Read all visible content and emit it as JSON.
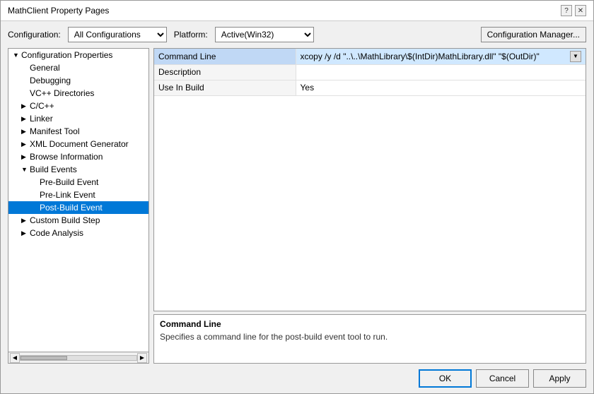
{
  "dialog": {
    "title": "MathClient Property Pages",
    "help_btn": "?",
    "close_btn": "✕"
  },
  "config_bar": {
    "config_label": "Configuration:",
    "config_value": "All Configurations",
    "platform_label": "Platform:",
    "platform_value": "Active(Win32)",
    "manager_btn": "Configuration Manager..."
  },
  "tree": {
    "items": [
      {
        "id": "config-props",
        "label": "Configuration Properties",
        "level": 0,
        "expanded": true,
        "has_children": true
      },
      {
        "id": "general",
        "label": "General",
        "level": 1,
        "expanded": false,
        "has_children": false
      },
      {
        "id": "debugging",
        "label": "Debugging",
        "level": 1,
        "expanded": false,
        "has_children": false
      },
      {
        "id": "vc-dirs",
        "label": "VC++ Directories",
        "level": 1,
        "expanded": false,
        "has_children": false
      },
      {
        "id": "cpp",
        "label": "C/C++",
        "level": 1,
        "expanded": false,
        "has_children": true,
        "collapsed": true
      },
      {
        "id": "linker",
        "label": "Linker",
        "level": 1,
        "expanded": false,
        "has_children": true,
        "collapsed": true
      },
      {
        "id": "manifest",
        "label": "Manifest Tool",
        "level": 1,
        "expanded": false,
        "has_children": true,
        "collapsed": true
      },
      {
        "id": "xml-doc",
        "label": "XML Document Generator",
        "level": 1,
        "expanded": false,
        "has_children": true,
        "collapsed": true
      },
      {
        "id": "browse",
        "label": "Browse Information",
        "level": 1,
        "expanded": false,
        "has_children": true,
        "collapsed": true
      },
      {
        "id": "build-events",
        "label": "Build Events",
        "level": 1,
        "expanded": true,
        "has_children": true
      },
      {
        "id": "pre-build",
        "label": "Pre-Build Event",
        "level": 2,
        "expanded": false,
        "has_children": false
      },
      {
        "id": "pre-link",
        "label": "Pre-Link Event",
        "level": 2,
        "expanded": false,
        "has_children": false
      },
      {
        "id": "post-build",
        "label": "Post-Build Event",
        "level": 2,
        "expanded": false,
        "has_children": false,
        "selected": true
      },
      {
        "id": "custom-build",
        "label": "Custom Build Step",
        "level": 1,
        "expanded": false,
        "has_children": true,
        "collapsed": true
      },
      {
        "id": "code-analysis",
        "label": "Code Analysis",
        "level": 1,
        "expanded": false,
        "has_children": true,
        "collapsed": true
      }
    ]
  },
  "grid": {
    "rows": [
      {
        "name": "Command Line",
        "value": "xcopy /y /d \"..\\..\\MathLibrary\\$(IntDir)MathLibrary.dll\" \"$(OutDir)\"",
        "selected": true,
        "has_dropdown": true
      },
      {
        "name": "Description",
        "value": "",
        "selected": false,
        "has_dropdown": false
      },
      {
        "name": "Use In Build",
        "value": "Yes",
        "selected": false,
        "has_dropdown": false
      }
    ]
  },
  "info_panel": {
    "title": "Command Line",
    "description": "Specifies a command line for the post-build event tool to run."
  },
  "buttons": {
    "ok": "OK",
    "cancel": "Cancel",
    "apply": "Apply"
  }
}
